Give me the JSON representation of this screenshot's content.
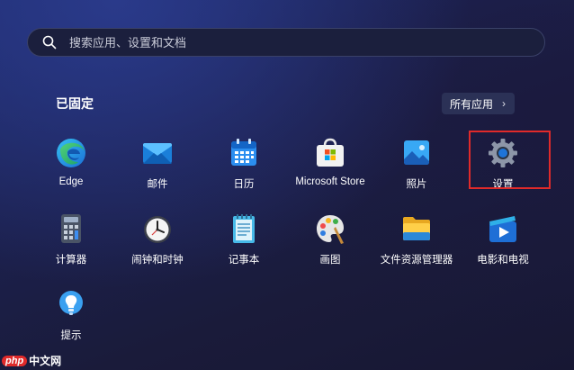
{
  "search": {
    "placeholder": "搜索应用、设置和文档",
    "icon": "search-icon"
  },
  "pinned": {
    "title": "已固定",
    "all_apps_label": "所有应用",
    "all_apps_chevron": "›"
  },
  "apps": [
    {
      "label": "Edge",
      "icon": "edge-icon"
    },
    {
      "label": "邮件",
      "icon": "mail-icon"
    },
    {
      "label": "日历",
      "icon": "calendar-icon"
    },
    {
      "label": "Microsoft Store",
      "icon": "store-icon"
    },
    {
      "label": "照片",
      "icon": "photos-icon"
    },
    {
      "label": "设置",
      "icon": "settings-gear-icon"
    },
    {
      "label": "计算器",
      "icon": "calculator-icon"
    },
    {
      "label": "闹钟和时钟",
      "icon": "clock-icon"
    },
    {
      "label": "记事本",
      "icon": "notepad-icon"
    },
    {
      "label": "画图",
      "icon": "paint-palette-icon"
    },
    {
      "label": "文件资源管理器",
      "icon": "folder-icon"
    },
    {
      "label": "电影和电视",
      "icon": "movies-tv-icon"
    },
    {
      "label": "提示",
      "icon": "tips-lightbulb-icon"
    }
  ],
  "highlight_color": "#e02a2a",
  "watermark": {
    "php": "php",
    "site": "中文网"
  }
}
